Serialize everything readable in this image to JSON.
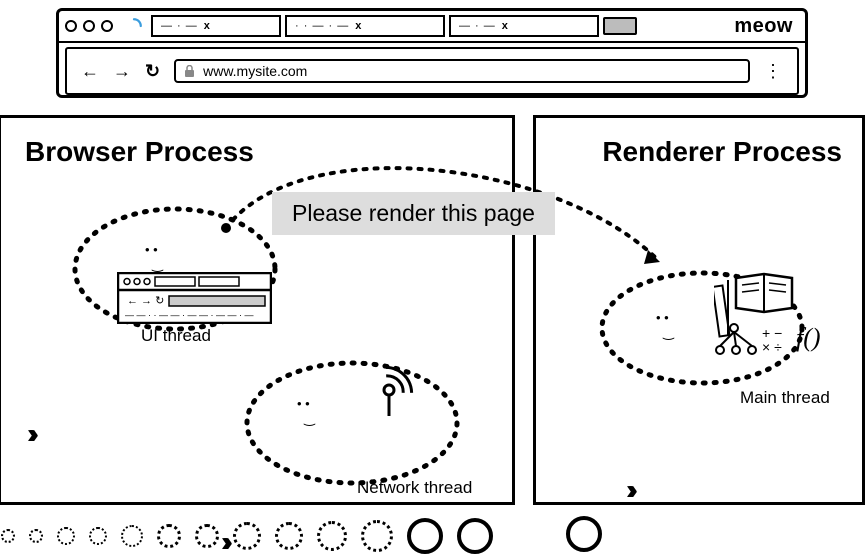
{
  "browser": {
    "url": "www.mysite.com",
    "brand": "meow",
    "tabs": [
      {
        "label": "— · —",
        "close": "x"
      },
      {
        "label": "· · — · —",
        "close": "x"
      },
      {
        "label": "— · —",
        "close": "x"
      }
    ],
    "nav": {
      "back": "←",
      "forward": "→",
      "reload": "↻",
      "menu": "⋮"
    }
  },
  "processes": {
    "browser": {
      "title": "Browser Process"
    },
    "renderer": {
      "title": "Renderer Process"
    }
  },
  "threads": {
    "ui": {
      "label": "UI thread"
    },
    "network": {
      "label": "Network thread"
    },
    "main": {
      "label": "Main thread"
    }
  },
  "message": {
    "text": "Please render this page"
  },
  "icons": {
    "spinner": "spinner-icon",
    "lock": "lock-icon",
    "antenna": "antenna-icon",
    "ruler": "ruler-icon",
    "book": "book-icon",
    "fx": "function-icon",
    "ops": "operators-icon",
    "minibrowser": "mini-browser-icon"
  }
}
